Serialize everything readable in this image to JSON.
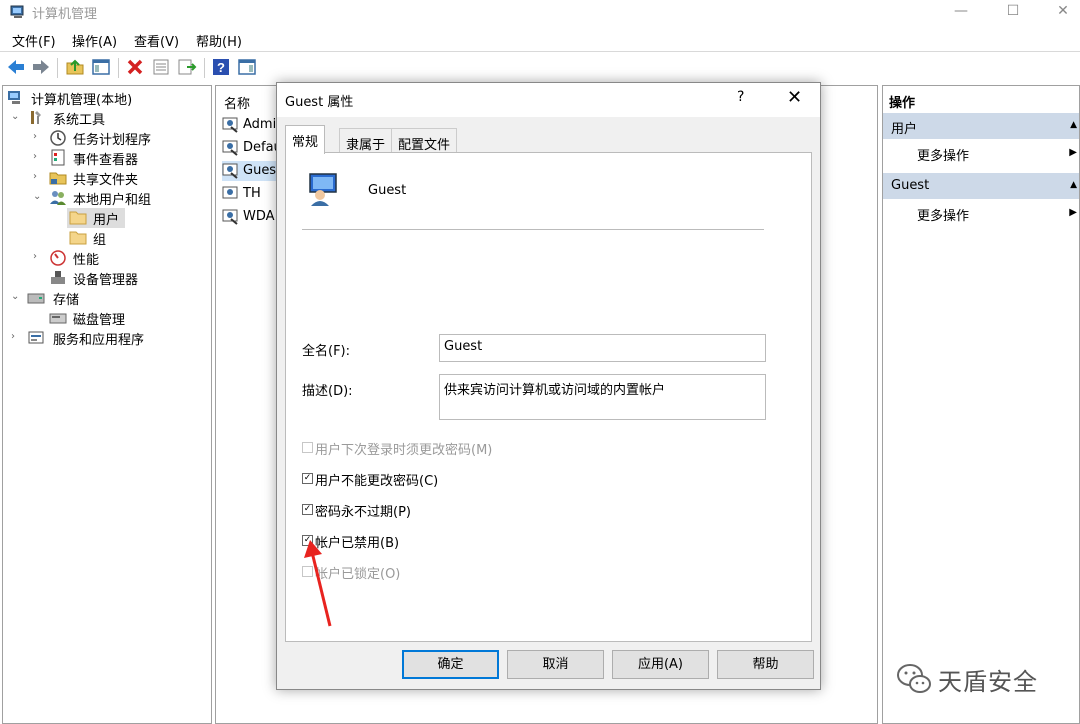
{
  "window": {
    "title": "计算机管理"
  },
  "menu": [
    "文件(F)",
    "操作(A)",
    "查看(V)",
    "帮助(H)"
  ],
  "tree": {
    "root": "计算机管理(本地)",
    "system_tools": "系统工具",
    "task_scheduler": "任务计划程序",
    "event_viewer": "事件查看器",
    "shared_folders": "共享文件夹",
    "local_users_groups": "本地用户和组",
    "users": "用户",
    "groups": "组",
    "performance": "性能",
    "device_manager": "设备管理器",
    "storage": "存储",
    "disk_management": "磁盘管理",
    "services_apps": "服务和应用程序"
  },
  "list": {
    "column_name": "名称",
    "rows": [
      "Admi",
      "Defau",
      "Guest",
      "TH",
      "WDA"
    ]
  },
  "actions": {
    "header": "操作",
    "group1": "用户",
    "group1_more": "更多操作",
    "group2": "Guest",
    "group2_more": "更多操作"
  },
  "dialog": {
    "title": "Guest 属性",
    "help": "?",
    "tabs": [
      "常规",
      "隶属于",
      "配置文件"
    ],
    "user_name": "Guest",
    "fullname_label": "全名(F):",
    "fullname_value": "Guest",
    "desc_label": "描述(D):",
    "desc_value": "供来宾访问计算机或访问域的内置帐户",
    "checkboxes": [
      {
        "label": "用户下次登录时须更改密码(M)",
        "checked": false,
        "disabled": true
      },
      {
        "label": "用户不能更改密码(C)",
        "checked": true,
        "disabled": false
      },
      {
        "label": "密码永不过期(P)",
        "checked": true,
        "disabled": false
      },
      {
        "label": "帐户已禁用(B)",
        "checked": true,
        "disabled": false
      },
      {
        "label": "帐户已锁定(O)",
        "checked": false,
        "disabled": true
      }
    ],
    "buttons": {
      "ok": "确定",
      "cancel": "取消",
      "apply": "应用(A)",
      "help": "帮助"
    }
  },
  "watermark": {
    "text": "天盾安全"
  }
}
